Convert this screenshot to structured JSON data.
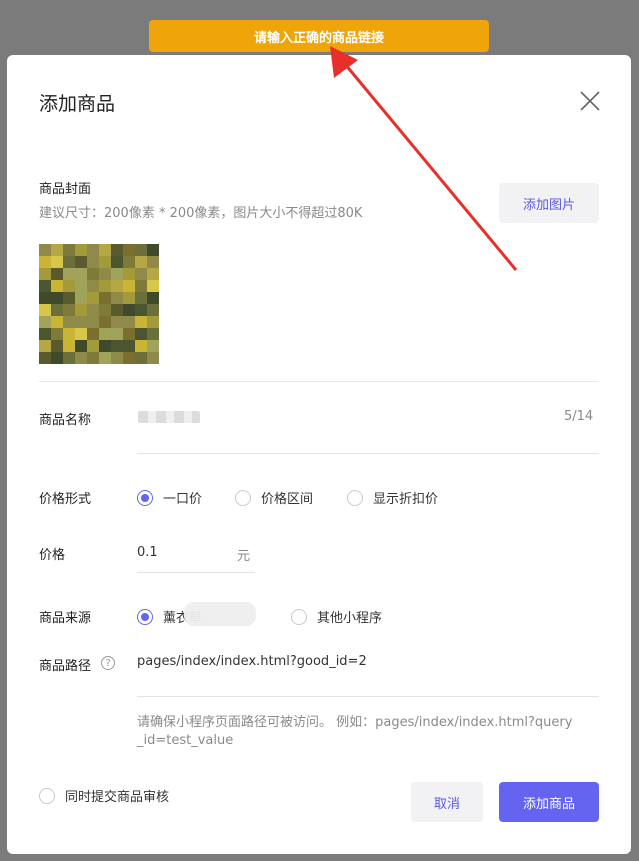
{
  "toast": {
    "message": "请输入正确的商品链接"
  },
  "dialog": {
    "title": "添加商品",
    "cover": {
      "label": "商品封面",
      "hint": "建议尺寸：200像素 * 200像素，图片大小不得超过80K",
      "add_image_label": "添加图片"
    },
    "name": {
      "label": "商品名称",
      "counter": "5/14"
    },
    "price_type": {
      "label": "价格形式",
      "options": [
        "一口价",
        "价格区间",
        "显示折扣价"
      ],
      "selected": "一口价"
    },
    "price": {
      "label": "价格",
      "value": "0.1",
      "unit": "元"
    },
    "source": {
      "label": "商品来源",
      "options": [
        "薰衣草",
        "其他小程序"
      ],
      "selected": "薰衣草"
    },
    "path": {
      "label": "商品路径",
      "help_icon": "question-icon",
      "value": "pages/index/index.html?good_id=2",
      "hint_line1": "请确保小程序页面路径可被访问。 例如：pages/index/index.html?query",
      "hint_line2": "_id=test_value"
    },
    "review_checkbox_label": "同时提交商品审核",
    "cancel_label": "取消",
    "submit_label": "添加商品"
  },
  "colors": {
    "toast_bg": "#efa409",
    "primary": "#6464f0",
    "annotation_arrow": "#e8302a"
  }
}
